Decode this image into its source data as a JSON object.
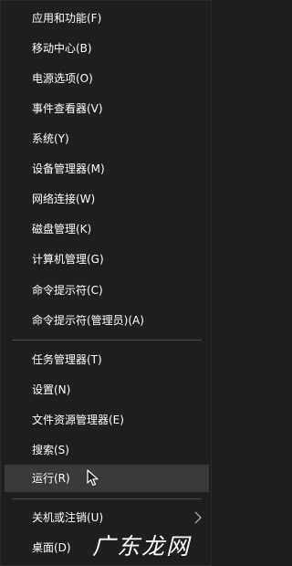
{
  "menu": {
    "group1": [
      {
        "label": "应用和功能(F)"
      },
      {
        "label": "移动中心(B)"
      },
      {
        "label": "电源选项(O)"
      },
      {
        "label": "事件查看器(V)"
      },
      {
        "label": "系统(Y)"
      },
      {
        "label": "设备管理器(M)"
      },
      {
        "label": "网络连接(W)"
      },
      {
        "label": "磁盘管理(K)"
      },
      {
        "label": "计算机管理(G)"
      },
      {
        "label": "命令提示符(C)"
      },
      {
        "label": "命令提示符(管理员)(A)"
      }
    ],
    "group2": [
      {
        "label": "任务管理器(T)"
      },
      {
        "label": "设置(N)"
      },
      {
        "label": "文件资源管理器(E)"
      },
      {
        "label": "搜索(S)"
      },
      {
        "label": "运行(R)"
      }
    ],
    "group3": [
      {
        "label": "关机或注销(U)",
        "icon": "chevron-right-icon"
      },
      {
        "label": "桌面(D)"
      }
    ],
    "hovered_item": "运行(R)"
  },
  "watermark": {
    "text": "广东龙网"
  },
  "colors": {
    "background": "#1f1f1f",
    "hover": "#3a3a3a",
    "separator": "#4a4a4a",
    "text": "#ffffff"
  }
}
